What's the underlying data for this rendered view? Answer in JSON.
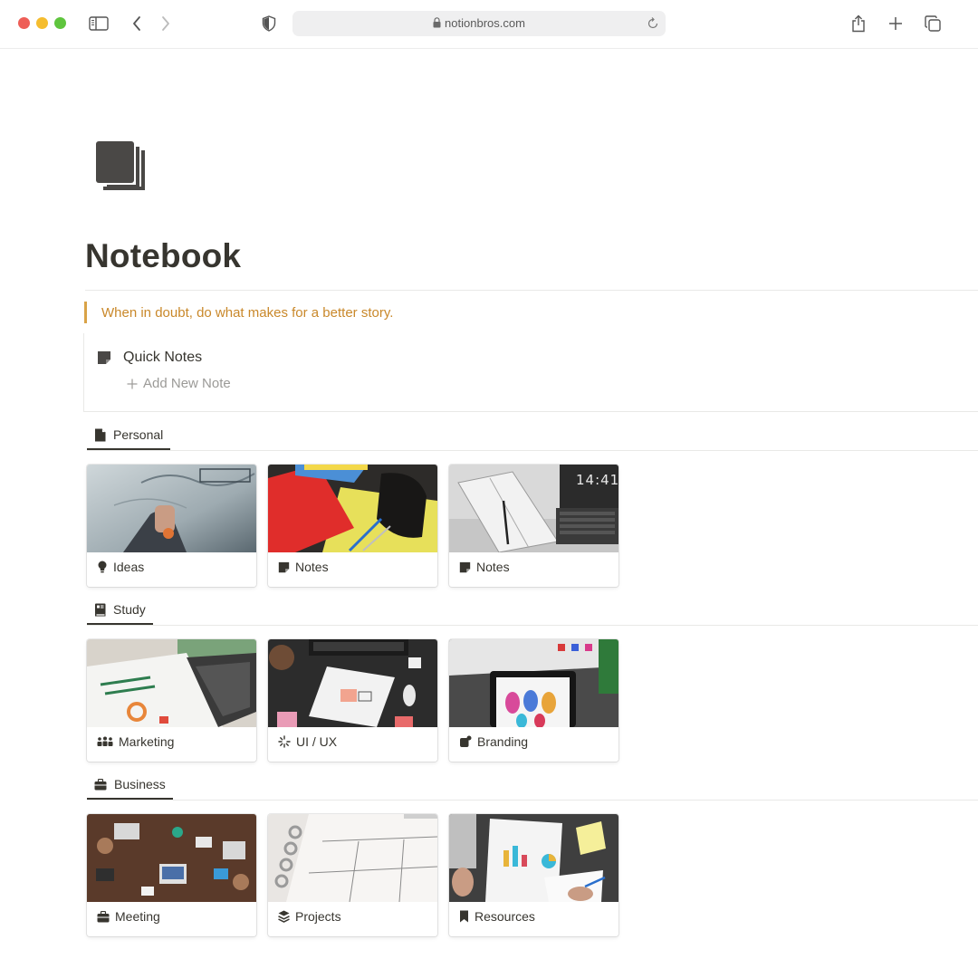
{
  "browser": {
    "url": "notionbros.com"
  },
  "page": {
    "title": "Notebook",
    "icon": "notebook-icon",
    "quote": "When in doubt, do what makes for a better story."
  },
  "quick_notes": {
    "title": "Quick Notes",
    "add_label": "Add New Note"
  },
  "sections": [
    {
      "label": "Personal",
      "icon": "document-icon",
      "cards": [
        {
          "label": "Ideas",
          "icon": "lightbulb-icon"
        },
        {
          "label": "Notes",
          "icon": "note-icon"
        },
        {
          "label": "Notes",
          "icon": "note-icon",
          "overlay_text": "14:41"
        }
      ]
    },
    {
      "label": "Study",
      "icon": "book-icon",
      "cards": [
        {
          "label": "Marketing",
          "icon": "people-icon"
        },
        {
          "label": "UI / UX",
          "icon": "sparkle-icon"
        },
        {
          "label": "Branding",
          "icon": "palette-icon"
        }
      ]
    },
    {
      "label": "Business",
      "icon": "briefcase-icon",
      "cards": [
        {
          "label": "Meeting",
          "icon": "briefcase-icon"
        },
        {
          "label": "Projects",
          "icon": "layers-icon"
        },
        {
          "label": "Resources",
          "icon": "bookmark-icon"
        }
      ]
    }
  ],
  "colors": {
    "text": "#37352f",
    "quote_accent": "#d9a347",
    "quote_text": "#c9882a",
    "muted": "#9b9a97"
  }
}
